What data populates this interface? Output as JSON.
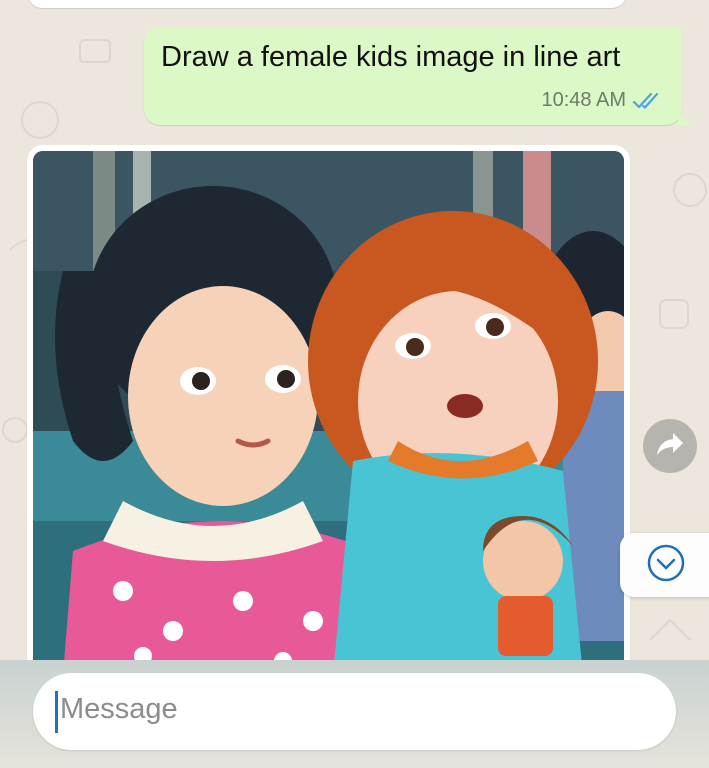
{
  "chat": {
    "outgoing_message": {
      "text": "Draw a female kids image in line art",
      "time": "10:48 AM",
      "status_icon": "double-check-icon"
    },
    "incoming_image": {
      "icon": "generated-line-art-image"
    }
  },
  "actions": {
    "forward_icon": "forward-arrow-icon",
    "scroll_down_icon": "chevron-down-circle-icon"
  },
  "composer": {
    "placeholder": "Message"
  },
  "colors": {
    "outgoing_bubble": "#dcf8c6",
    "read_tick": "#4fa3e0",
    "wallpaper": "#ece6dc",
    "caret": "#1a73c8"
  }
}
